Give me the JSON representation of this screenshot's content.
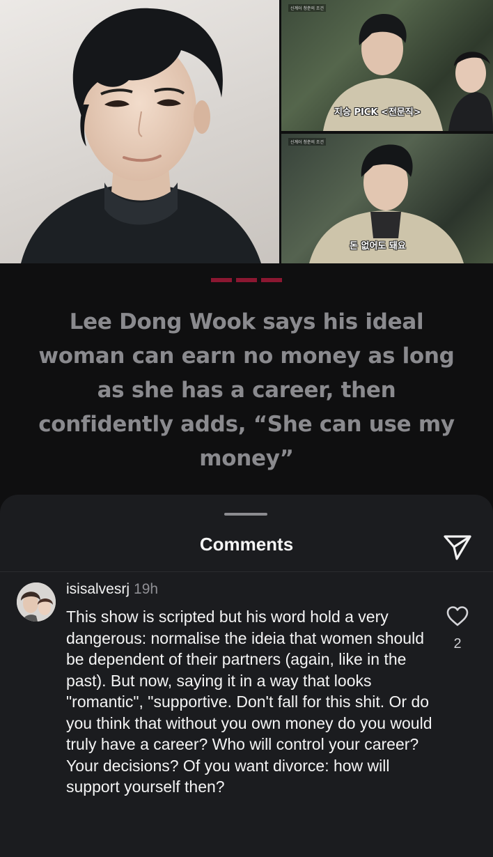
{
  "post": {
    "captions": {
      "top": "지승 PICK <전문직>",
      "bottom": "돈 없어도 돼요"
    },
    "show_tag": "신계어 청춘의 조건",
    "headline": "Lee Dong Wook says his ideal woman can earn no money as long as she has a career, then confidently adds, “She can use my money”",
    "accent_color": "#8b1731"
  },
  "comments_sheet": {
    "title": "Comments",
    "send_icon": "paper-plane-icon",
    "comment": {
      "username": "isisalvesrj",
      "time": "19h",
      "text": "This show is scripted but his word hold a very dangerous: normalise the ideia that women should be dependent of their partners (again, like in the past). But now, saying it in a way that looks \"romantic\", \"supportive. Don't fall for this shit. Or do you think that without you own money do you would truly have a career? Who will control your career? Your decisions? Of you want divorce: how will support yourself then?",
      "like_icon": "heart-outline-icon",
      "likes": "2"
    }
  }
}
